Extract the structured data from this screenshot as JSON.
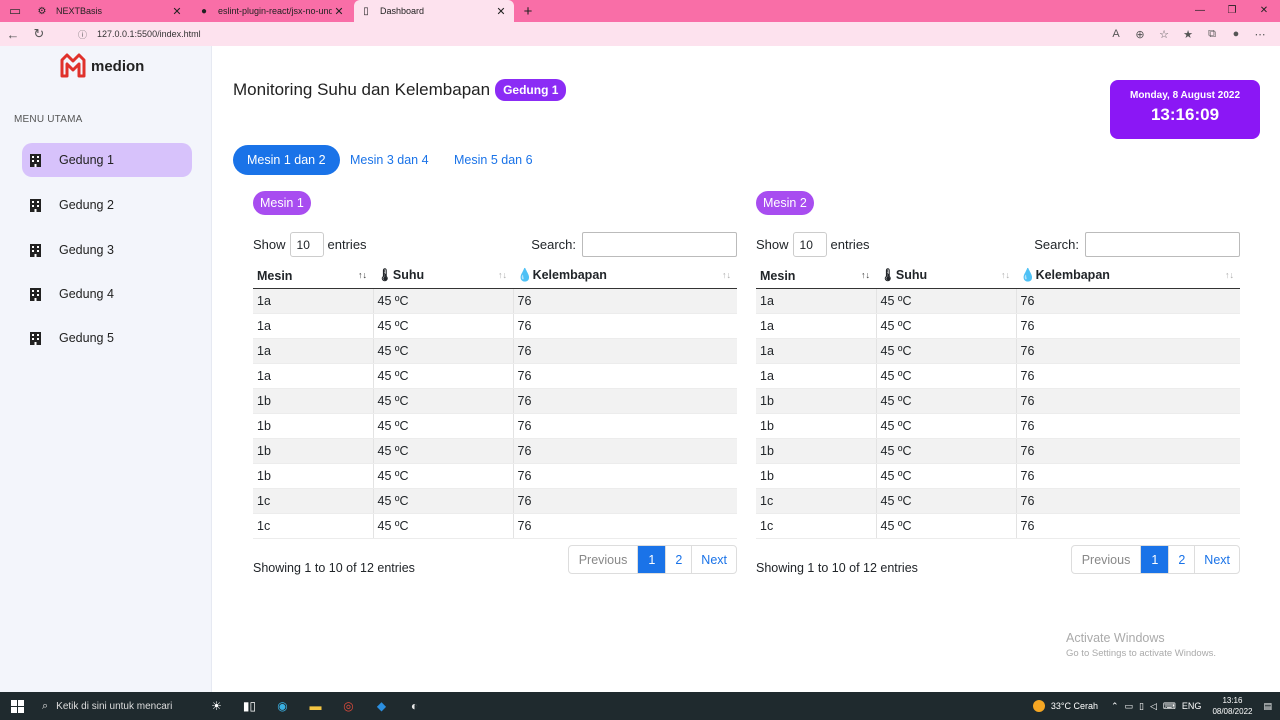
{
  "browser": {
    "tabs": [
      {
        "title": "NEXTBasis",
        "icon": "gear-icon",
        "active": false
      },
      {
        "title": "eslint-plugin-react/jsx-no-undef",
        "icon": "github-icon",
        "active": false
      },
      {
        "title": "Dashboard",
        "icon": "page-icon",
        "active": true
      }
    ],
    "url": "127.0.0.1:5500/index.html"
  },
  "sidebar": {
    "logo_text": "medion",
    "menu_title": "MENU UTAMA",
    "items": [
      {
        "label": "Gedung 1",
        "active": true
      },
      {
        "label": "Gedung 2",
        "active": false
      },
      {
        "label": "Gedung 3",
        "active": false
      },
      {
        "label": "Gedung 4",
        "active": false
      },
      {
        "label": "Gedung 5",
        "active": false
      }
    ]
  },
  "header": {
    "title": "Monitoring Suhu dan Kelembapan",
    "badge": "Gedung 1",
    "date": "Monday, 8 August 2022",
    "time": "13:16:09"
  },
  "tabs": [
    {
      "label": "Mesin 1 dan 2",
      "active": true
    },
    {
      "label": "Mesin 3 dan 4",
      "active": false
    },
    {
      "label": "Mesin 5 dan 6",
      "active": false
    }
  ],
  "panels": [
    {
      "title": "Mesin 1",
      "show_label": "Show",
      "entries_value": "10",
      "entries_label": "entries",
      "search_label": "Search:",
      "columns": [
        "Mesin",
        "Suhu",
        "Kelembapan"
      ],
      "rows": [
        [
          "1a",
          "45 ºC",
          "76"
        ],
        [
          "1a",
          "45 ºC",
          "76"
        ],
        [
          "1a",
          "45 ºC",
          "76"
        ],
        [
          "1a",
          "45 ºC",
          "76"
        ],
        [
          "1b",
          "45 ºC",
          "76"
        ],
        [
          "1b",
          "45 ºC",
          "76"
        ],
        [
          "1b",
          "45 ºC",
          "76"
        ],
        [
          "1b",
          "45 ºC",
          "76"
        ],
        [
          "1c",
          "45 ºC",
          "76"
        ],
        [
          "1c",
          "45 ºC",
          "76"
        ]
      ],
      "info": "Showing 1 to 10 of 12 entries",
      "pager": {
        "prev": "Previous",
        "pages": [
          "1",
          "2"
        ],
        "next": "Next"
      }
    },
    {
      "title": "Mesin 2",
      "show_label": "Show",
      "entries_value": "10",
      "entries_label": "entries",
      "search_label": "Search:",
      "columns": [
        "Mesin",
        "Suhu",
        "Kelembapan"
      ],
      "rows": [
        [
          "1a",
          "45 ºC",
          "76"
        ],
        [
          "1a",
          "45 ºC",
          "76"
        ],
        [
          "1a",
          "45 ºC",
          "76"
        ],
        [
          "1a",
          "45 ºC",
          "76"
        ],
        [
          "1b",
          "45 ºC",
          "76"
        ],
        [
          "1b",
          "45 ºC",
          "76"
        ],
        [
          "1b",
          "45 ºC",
          "76"
        ],
        [
          "1b",
          "45 ºC",
          "76"
        ],
        [
          "1c",
          "45 ºC",
          "76"
        ],
        [
          "1c",
          "45 ºC",
          "76"
        ]
      ],
      "info": "Showing 1 to 10 of 12 entries",
      "pager": {
        "prev": "Previous",
        "pages": [
          "1",
          "2"
        ],
        "next": "Next"
      }
    }
  ],
  "watermark": {
    "line1": "Activate Windows",
    "line2": "Go to Settings to activate Windows."
  },
  "taskbar": {
    "search_placeholder": "Ketik di sini untuk mencari",
    "weather": "33°C  Cerah",
    "lang": "ENG",
    "time": "13:16",
    "date": "08/08/2022"
  },
  "colors": {
    "accent": "#8b17f5",
    "primary": "#1a73e8",
    "tabbar": "#f96ea7"
  }
}
